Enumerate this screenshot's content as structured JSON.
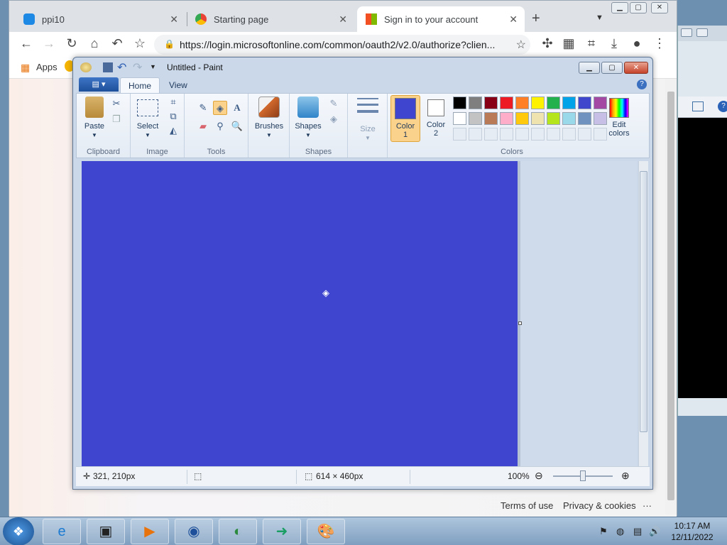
{
  "browser": {
    "tabs": [
      {
        "title": "ppi10"
      },
      {
        "title": "Starting page"
      },
      {
        "title": "Sign in to your account"
      }
    ],
    "url": "https://login.microsoftonline.com/common/oauth2/v2.0/authorize?clien...",
    "bookmarks": {
      "apps_label": "Apps"
    },
    "footer": {
      "terms": "Terms of use",
      "privacy": "Privacy & cookies",
      "more": "···"
    }
  },
  "paint": {
    "title": "Untitled - Paint",
    "tabs": {
      "home": "Home",
      "view": "View"
    },
    "groups": {
      "clipboard": "Clipboard",
      "image": "Image",
      "tools": "Tools",
      "shapes": "Shapes",
      "colors": "Colors"
    },
    "buttons": {
      "paste": "Paste",
      "select": "Select",
      "brushes": "Brushes",
      "shapes": "Shapes",
      "size": "Size",
      "color1_a": "Color",
      "color1_b": "1",
      "color2_a": "Color",
      "color2_b": "2",
      "edit_a": "Edit",
      "edit_b": "colors"
    },
    "colors": {
      "color1": "#3f45cf",
      "color2": "#ffffff",
      "canvas": "#3f45cf",
      "palette_row1": [
        "#000000",
        "#7f7f7f",
        "#880015",
        "#ed1c24",
        "#ff7f27",
        "#fff200",
        "#22b14c",
        "#00a2e8",
        "#3f48cc",
        "#a349a4"
      ],
      "palette_row2": [
        "#ffffff",
        "#c3c3c3",
        "#b97a57",
        "#ffaec9",
        "#ffc90e",
        "#efe4b0",
        "#b5e61d",
        "#99d9ea",
        "#7092be",
        "#c8bfe7"
      ]
    },
    "status": {
      "cursor_pos": "321, 210px",
      "canvas_size": "614 × 460px",
      "zoom": "100%"
    }
  },
  "taskbar": {
    "time": "10:17 AM",
    "date": "12/11/2022"
  }
}
